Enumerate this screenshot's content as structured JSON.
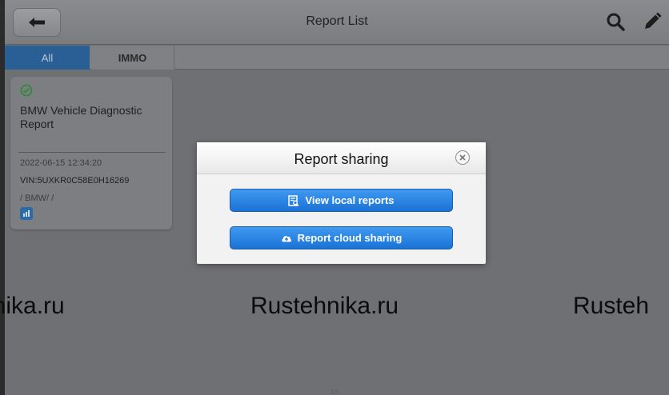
{
  "header": {
    "title": "Report List",
    "back_icon": "arrow-left-icon",
    "search_icon": "search-icon",
    "edit_icon": "pencil-icon"
  },
  "tabs": [
    {
      "label": "All",
      "active": true
    },
    {
      "label": "IMMO",
      "active": false
    }
  ],
  "report_card": {
    "status_icon": "check-circle-icon",
    "title": "BMW Vehicle Diagnostic Report",
    "date": "2022-06-15 12:34:20",
    "vin": "VIN:5UXKR0C58E0H16269",
    "make": "/ BMW/ /",
    "badge_icon": "signal-icon"
  },
  "dialog": {
    "title": "Report sharing",
    "close_icon": "close-circle-icon",
    "buttons": [
      {
        "label": "View local reports",
        "icon": "report-search-icon"
      },
      {
        "label": "Report cloud sharing",
        "icon": "cloud-upload-icon"
      }
    ]
  },
  "watermarks": [
    "hnika.ru",
    "Rustehnika.ru",
    "Rusteh"
  ],
  "page_indicator": "1/1",
  "colors": {
    "active_tab": "#2a5f95",
    "button_blue": "#2a86e6",
    "overlay": "#6f7073"
  }
}
